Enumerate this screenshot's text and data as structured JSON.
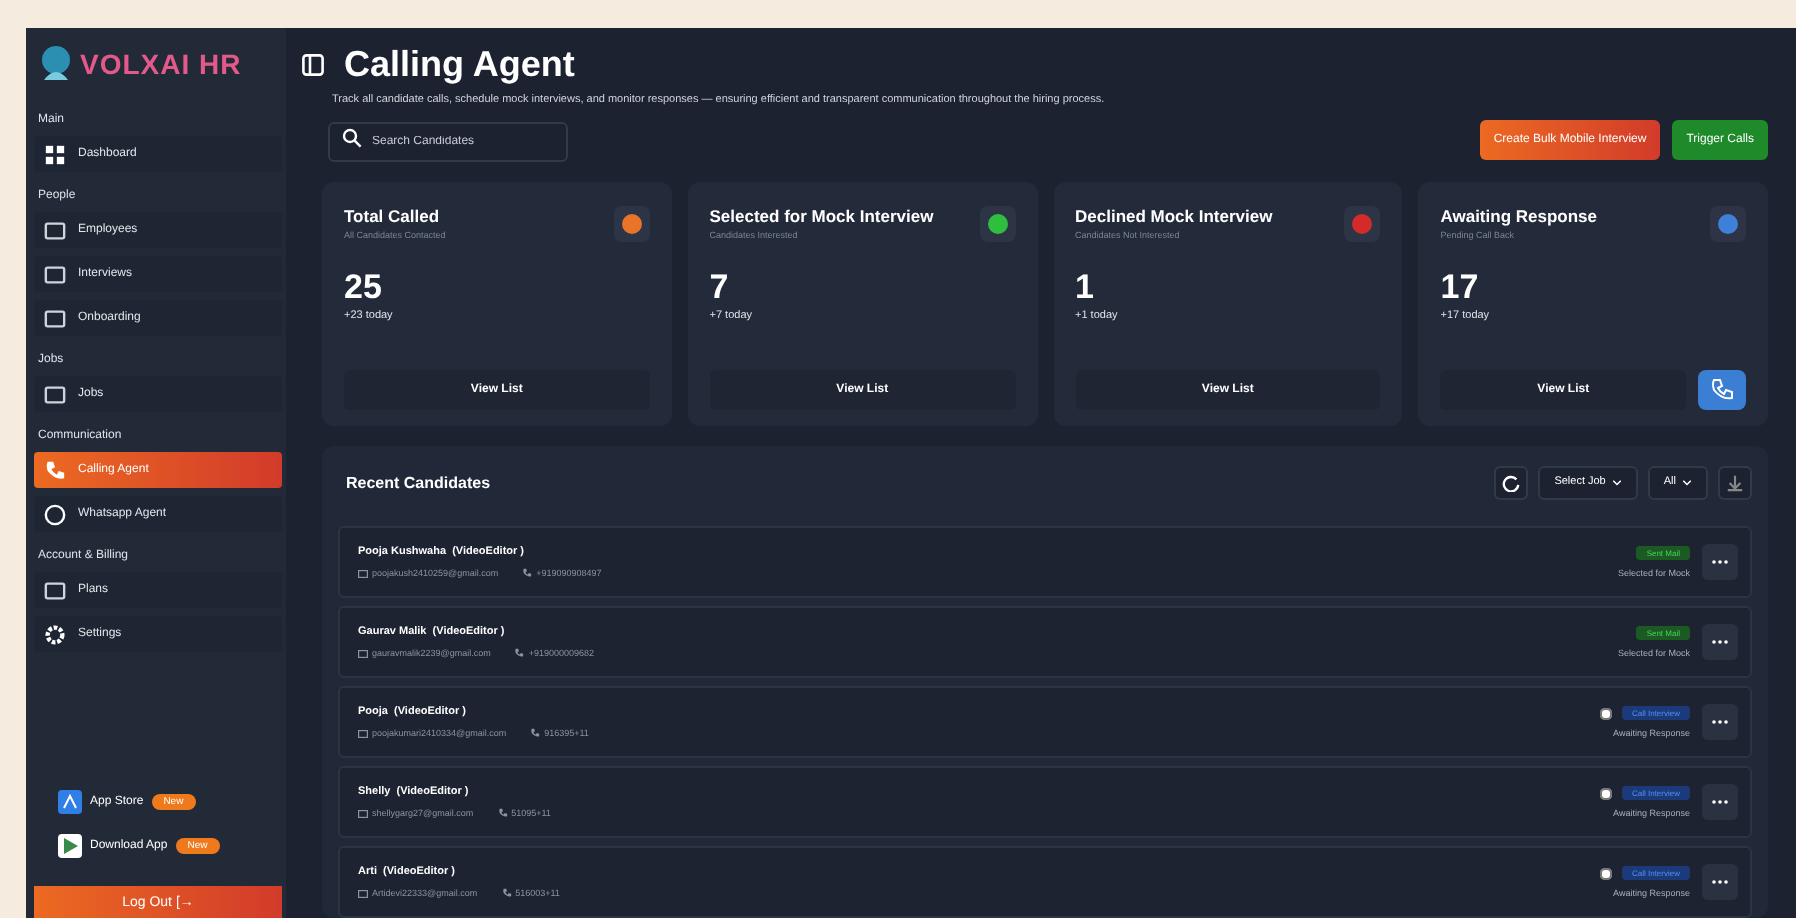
{
  "brand": {
    "name": "VOLXAI HR"
  },
  "sidebar": {
    "sections": [
      {
        "title": "Main",
        "items": [
          {
            "label": "Dashboard",
            "selected": false
          }
        ]
      },
      {
        "title": "People",
        "items": [
          {
            "label": "Employees",
            "selected": false
          },
          {
            "label": "Interviews",
            "selected": false
          },
          {
            "label": "Onboarding",
            "selected": false
          }
        ]
      },
      {
        "title": "Jobs",
        "items": [
          {
            "label": "Jobs",
            "selected": false
          }
        ]
      },
      {
        "title": "Communication",
        "items": [
          {
            "label": "Calling Agent",
            "selected": true
          },
          {
            "label": "Whatsapp Agent",
            "selected": false
          }
        ]
      },
      {
        "title": "Account & Billing",
        "items": [
          {
            "label": "Plans",
            "selected": false
          },
          {
            "label": "Settings",
            "selected": false
          }
        ]
      }
    ],
    "apps": [
      {
        "label": "App Store",
        "badge": "New"
      },
      {
        "label": "Download App",
        "badge": "New"
      }
    ],
    "logout": "Log Out [→"
  },
  "header": {
    "title": "Calling Agent",
    "description": "Track all candidate calls, schedule mock interviews, and monitor responses — ensuring efficient and transparent communication throughout the hiring process."
  },
  "search": {
    "placeholder": "Search Candidates"
  },
  "actions": [
    {
      "label": "Create Bulk Mobile Interview",
      "kind": "orange"
    },
    {
      "label": "Trigger Calls",
      "kind": "green"
    }
  ],
  "stats": [
    {
      "title": "Total Called",
      "subtitle": "All Candidates Contacted",
      "value": "25",
      "delta": "+23 today",
      "button": "View List",
      "color": "#e8742a"
    },
    {
      "title": "Selected for Mock Interview",
      "subtitle": "Candidates Interested",
      "value": "7",
      "delta": "+7 today",
      "button": "View List",
      "color": "#2fbf3f"
    },
    {
      "title": "Declined Mock Interview",
      "subtitle": "Candidates Not Interested",
      "value": "1",
      "delta": "+1 today",
      "button": "View List",
      "color": "#d42a2a"
    },
    {
      "title": "Awaiting Response",
      "subtitle": "Pending Call Back",
      "value": "17",
      "delta": "+17 today",
      "button": "View List",
      "color": "#3f7fd8"
    }
  ],
  "recent": {
    "title": "Recent Candidates",
    "filters": [
      "Select Job",
      "All"
    ],
    "rows": [
      {
        "name": "Pooja Kushwaha",
        "role": "(VideoEditor )",
        "email": "poojakush2410259@gmail.com",
        "phone": "+919090908497",
        "badge": "Sent Mail",
        "kind": "green",
        "status": "Selected for Mock"
      },
      {
        "name": "Gaurav Malik",
        "role": "(VideoEditor )",
        "email": "gauravmalik2239@gmail.com",
        "phone": "+919000009682",
        "badge": "Sent Mail",
        "kind": "green",
        "status": "Selected for Mock"
      },
      {
        "name": "Pooja",
        "role": "(VideoEditor )",
        "email": "poojakumari2410334@gmail.com",
        "phone": "916395+11",
        "badge": "Call Interview",
        "kind": "blue",
        "status": "Awaiting Response",
        "checked": false
      },
      {
        "name": "Shelly",
        "role": "(VideoEditor )",
        "email": "shellygarg27@gmail.com",
        "phone": "51095+11",
        "badge": "Call Interview",
        "kind": "blue",
        "status": "Awaiting Response",
        "checked": false
      },
      {
        "name": "Arti",
        "role": "(VideoEditor )",
        "email": "Artidevi22333@gmail.com",
        "phone": "516003+11",
        "badge": "Call Interview",
        "kind": "blue",
        "status": "Awaiting Response",
        "checked": false
      }
    ]
  }
}
